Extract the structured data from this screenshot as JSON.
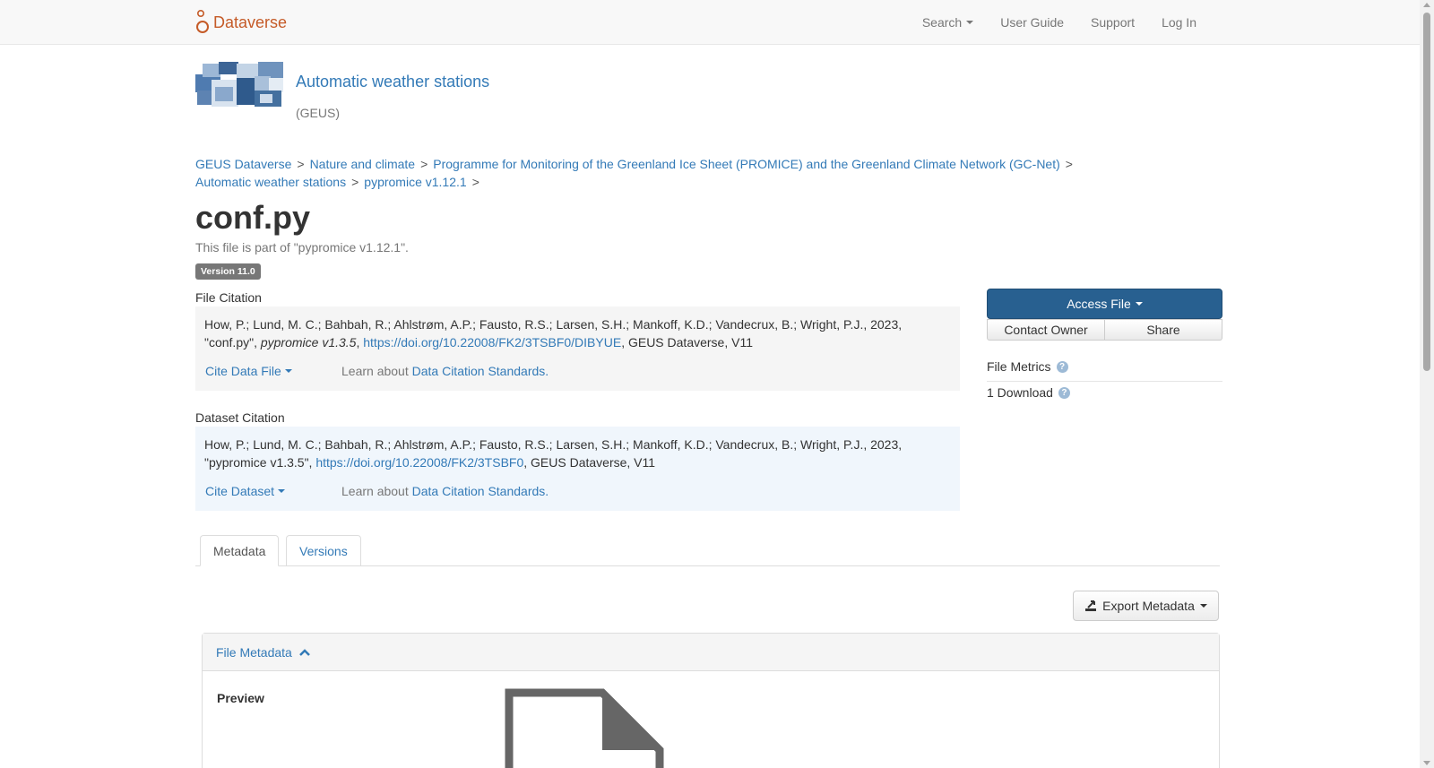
{
  "navbar": {
    "brand": "Dataverse",
    "search": "Search",
    "user_guide": "User Guide",
    "support": "Support",
    "log_in": "Log In"
  },
  "dataverse": {
    "title": "Automatic weather stations",
    "affiliation": "(GEUS)"
  },
  "breadcrumb": [
    "GEUS Dataverse",
    "Nature and climate",
    "Programme for Monitoring of the Greenland Ice Sheet (PROMICE) and the Greenland Climate Network (GC-Net)",
    "Automatic weather stations",
    "pypromice v1.12.1"
  ],
  "breadcrumb_sep": ">",
  "file": {
    "title": "conf.py",
    "part_of": "This file is part of \"pypromice v1.12.1\".",
    "version": "Version 11.0"
  },
  "file_citation": {
    "label": "File Citation",
    "text_pre": "How, P.; Lund, M. C.; Bahbah, R.; Ahlstrøm, A.P.; Fausto, R.S.; Larsen, S.H.; Mankoff, K.D.; Vandecrux, B.; Wright, P.J., 2023, \"conf.py\", ",
    "text_italic": "pypromice v1.3.5",
    "text_comma": ", ",
    "doi": "https://doi.org/10.22008/FK2/3TSBF0/DIBYUE",
    "text_post": ", GEUS Dataverse, V11",
    "cite_button": "Cite Data File",
    "learn_prefix": "Learn about ",
    "learn_link": "Data Citation Standards."
  },
  "dataset_citation": {
    "label": "Dataset Citation",
    "text_pre": "How, P.; Lund, M. C.; Bahbah, R.; Ahlstrøm, A.P.; Fausto, R.S.; Larsen, S.H.; Mankoff, K.D.; Vandecrux, B.; Wright, P.J., 2023, \"pypromice v1.3.5\", ",
    "doi": "https://doi.org/10.22008/FK2/3TSBF0",
    "text_post": ", GEUS Dataverse, V11",
    "cite_button": "Cite Dataset",
    "learn_prefix": "Learn about ",
    "learn_link": "Data Citation Standards."
  },
  "actions": {
    "access_file": "Access File",
    "contact_owner": "Contact Owner",
    "share": "Share"
  },
  "metrics": {
    "title": "File Metrics",
    "downloads": "1 Download"
  },
  "tabs": [
    "Metadata",
    "Versions"
  ],
  "export_metadata": "Export Metadata",
  "panel": {
    "title": "File Metadata",
    "preview_label": "Preview"
  },
  "colors": {
    "brand": "#c55b28",
    "link": "#337ab7",
    "primary_button": "#286090"
  }
}
